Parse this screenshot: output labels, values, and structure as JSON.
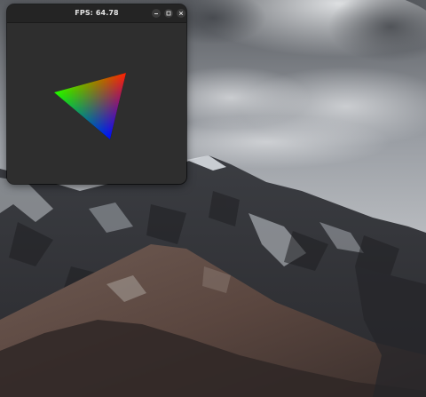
{
  "window": {
    "title": "FPS: 64.78",
    "controls": {
      "minimize_icon": "minimize-icon",
      "maximize_icon": "maximize-icon",
      "close_icon": "close-icon"
    },
    "viewport": {
      "background": "#2e2e2e",
      "triangle_colors": [
        "#ff0000",
        "#00ff00",
        "#0000ff"
      ]
    }
  },
  "desktop": {
    "wallpaper": "mountain-landscape-cloudy-sky"
  }
}
